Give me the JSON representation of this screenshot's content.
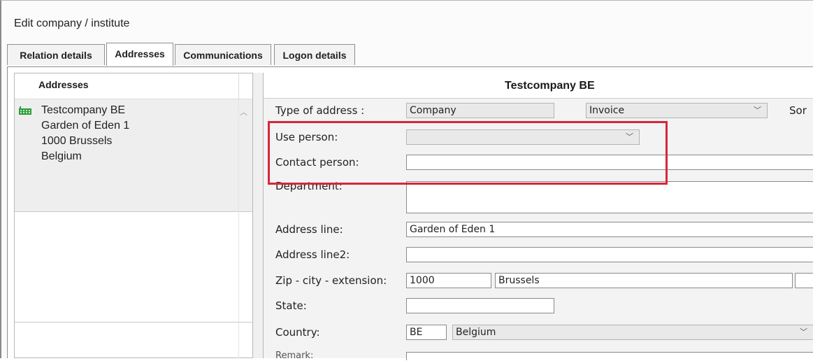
{
  "window": {
    "title": "Edit company / institute"
  },
  "tabs": [
    {
      "label": "Relation details"
    },
    {
      "label": "Addresses"
    },
    {
      "label": "Communications"
    },
    {
      "label": "Logon details"
    }
  ],
  "left_panel": {
    "header": "Addresses",
    "address_card": {
      "lines": [
        "Testcompany BE",
        "Garden of Eden 1",
        "1000 Brussels",
        "Belgium"
      ]
    }
  },
  "right_panel": {
    "company_name": "Testcompany BE",
    "form": {
      "type_of_address": {
        "label": "Type of address :",
        "value": "Company",
        "second_value": "Invoice",
        "trailing_label": "Sor"
      },
      "use_person": {
        "label": "Use person:",
        "value": ""
      },
      "contact_person": {
        "label": "Contact person:",
        "value": ""
      },
      "department": {
        "label": "Department:",
        "value": ""
      },
      "address_line": {
        "label": "Address line:",
        "value": "Garden of Eden 1"
      },
      "address_line2": {
        "label": "Address line2:",
        "value": ""
      },
      "zip_city": {
        "label": "Zip - city - extension:",
        "zip": "1000",
        "city": "Brussels",
        "extension": ""
      },
      "state": {
        "label": "State:",
        "value": ""
      },
      "country": {
        "label": "Country:",
        "code": "BE",
        "name": "Belgium"
      },
      "next_label": "Remark:"
    }
  },
  "highlight": {
    "color": "#d6273a"
  }
}
